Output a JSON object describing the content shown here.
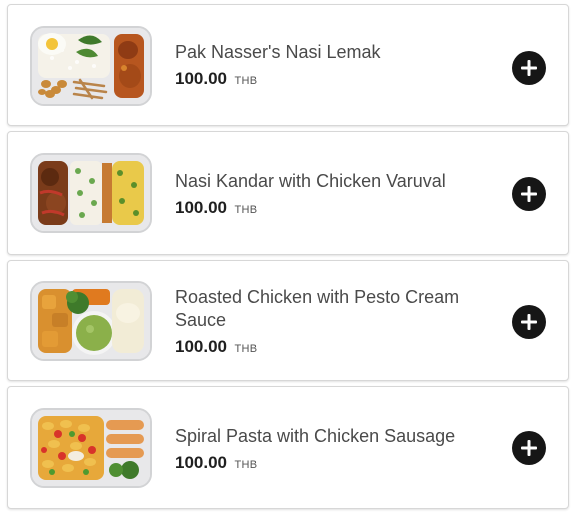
{
  "items": [
    {
      "name": "Pak Nasser's Nasi Lemak",
      "price": "100.00",
      "currency": "THB",
      "image": "nasi-lemak-meal-tray"
    },
    {
      "name": "Nasi Kandar with Chicken Varuval",
      "price": "100.00",
      "currency": "THB",
      "image": "nasi-kandar-meal-tray"
    },
    {
      "name": "Roasted Chicken with Pesto Cream Sauce",
      "price": "100.00",
      "currency": "THB",
      "image": "roasted-chicken-meal-tray"
    },
    {
      "name": "Spiral Pasta with Chicken Sausage",
      "price": "100.00",
      "currency": "THB",
      "image": "spiral-pasta-meal-tray"
    }
  ],
  "add_icon": "plus-circle-icon",
  "colors": {
    "add_button": "#161616",
    "border": "#d7d7d7",
    "text": "#4a4a4a"
  }
}
